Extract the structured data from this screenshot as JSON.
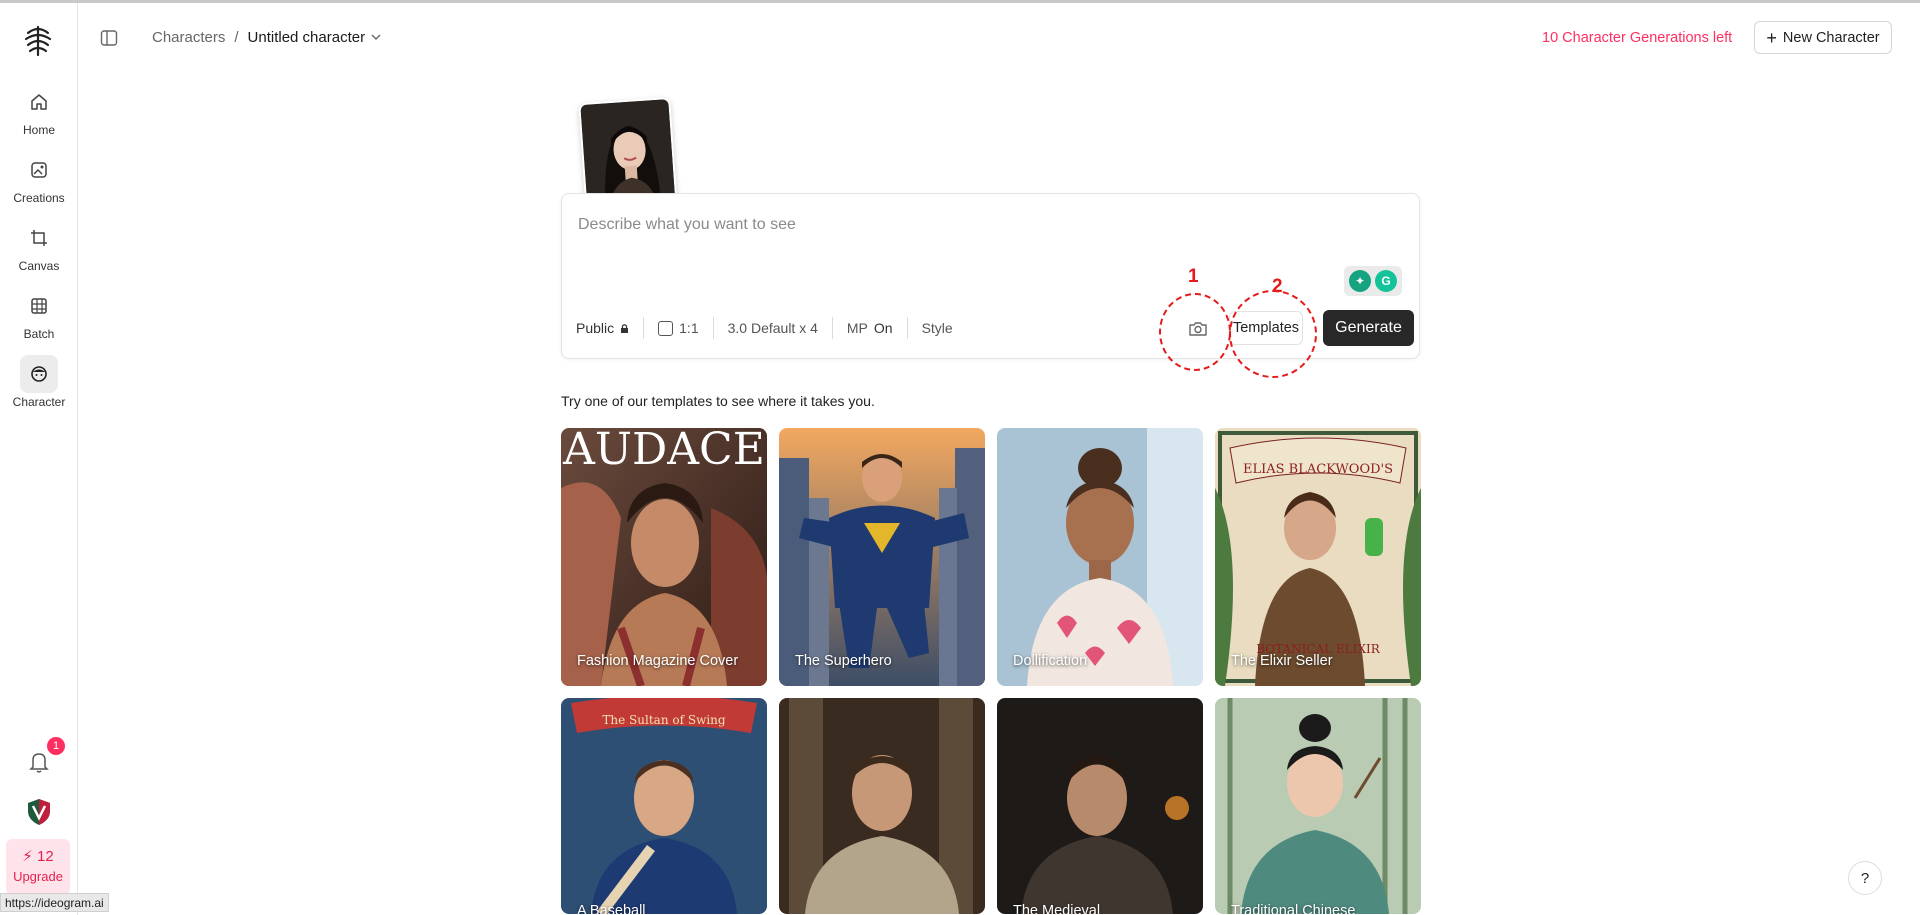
{
  "header": {
    "breadcrumb_root": "Characters",
    "breadcrumb_sep": "/",
    "breadcrumb_current": "Untitled character",
    "generations_left": "10 Character Generations left",
    "new_character_label": "New Character"
  },
  "sidebar": {
    "items": [
      {
        "label": "Home",
        "icon": "home-icon"
      },
      {
        "label": "Creations",
        "icon": "image-icon"
      },
      {
        "label": "Canvas",
        "icon": "crop-icon"
      },
      {
        "label": "Batch",
        "icon": "grid-icon"
      },
      {
        "label": "Character",
        "icon": "face-icon"
      }
    ],
    "notification_count": "1",
    "credits": "12",
    "upgrade_label": "Upgrade"
  },
  "prompt": {
    "placeholder": "Describe what you want to see",
    "visibility": "Public",
    "aspect_ratio": "1:1",
    "model": "3.0 Default x 4",
    "mp_label": "MP",
    "mp_value": "On",
    "style_label": "Style",
    "templates_label": "Templates",
    "generate_label": "Generate"
  },
  "annotations": {
    "one": "1",
    "two": "2"
  },
  "templates_intro": "Try one of our templates to see where it takes you.",
  "templates": [
    {
      "title": "Fashion Magazine Cover",
      "masthead": "AUDACE"
    },
    {
      "title": "The Superhero"
    },
    {
      "title": "Dollification"
    },
    {
      "title": "The Elixir Seller",
      "sign_top": "ELIAS BLACKWOOD'S",
      "sign_bottom": "BOTANICAL ELIXIR"
    },
    {
      "title": "A Baseball",
      "sign_top": "The Sultan of Swing"
    },
    {
      "title": ""
    },
    {
      "title": "The Medieval"
    },
    {
      "title": "Traditional Chinese"
    }
  ],
  "status_url": "https://ideogram.ai",
  "help_label": "?"
}
